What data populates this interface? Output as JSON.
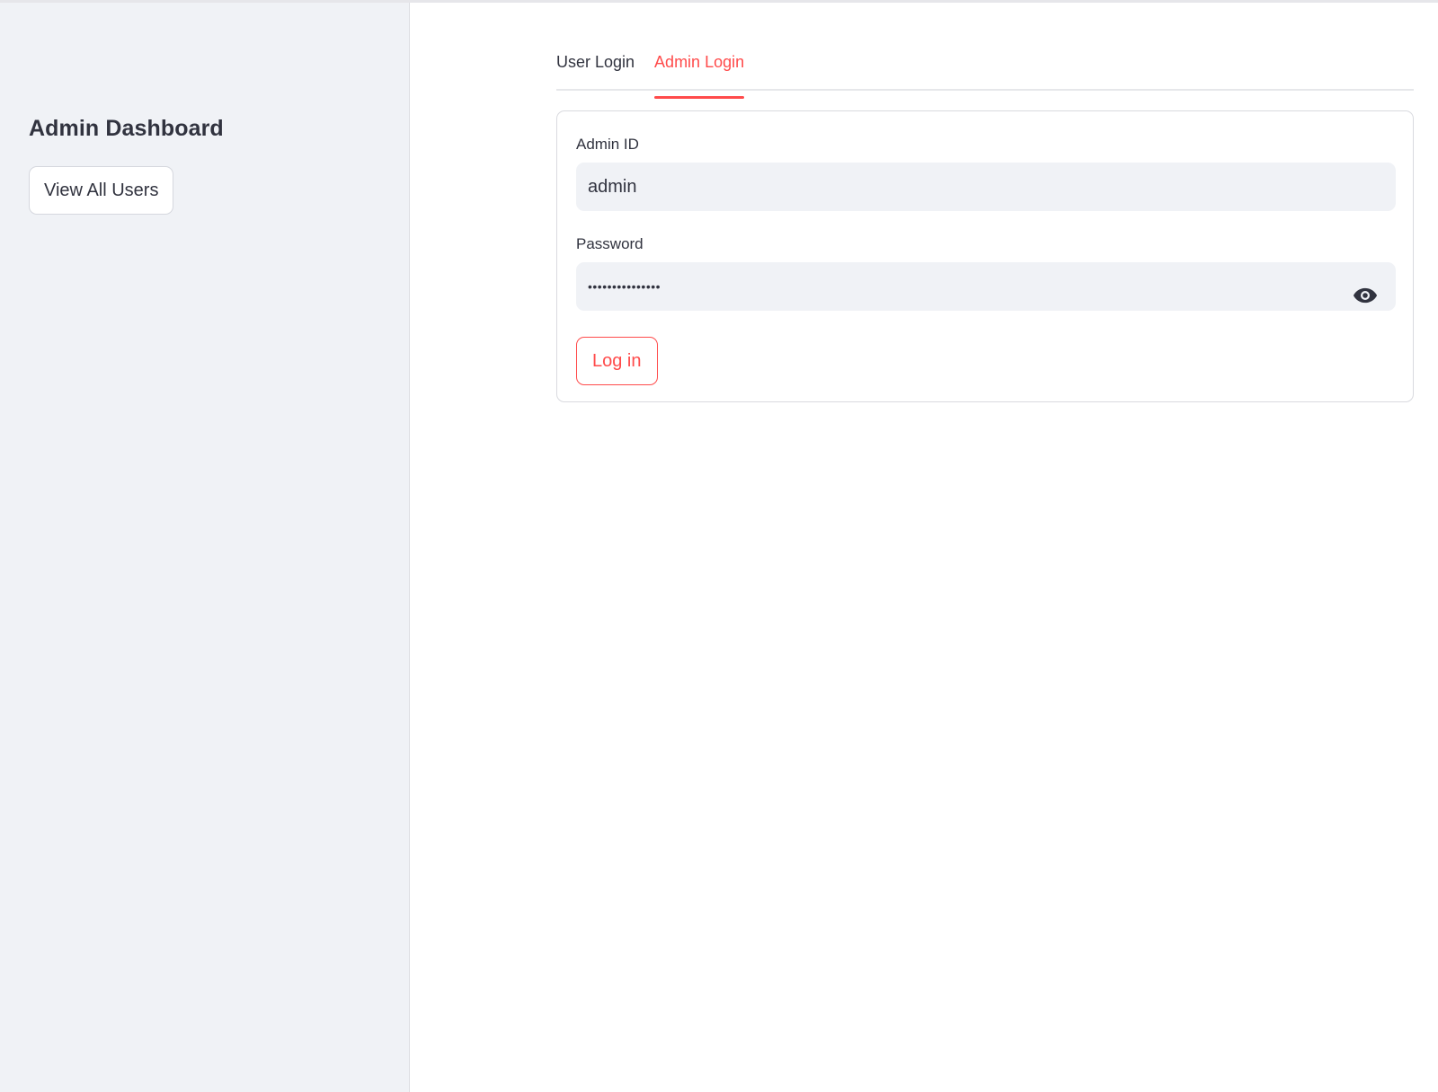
{
  "sidebar": {
    "title": "Admin Dashboard",
    "button_label": "View All Users"
  },
  "tabs": [
    {
      "label": "User Login",
      "active": false
    },
    {
      "label": "Admin Login",
      "active": true
    }
  ],
  "form": {
    "admin_id": {
      "label": "Admin ID",
      "value": "admin"
    },
    "password": {
      "label": "Password",
      "masked_value": "•••••••••••••••",
      "toggle_icon": "eye-icon"
    },
    "submit_label": "Log in"
  },
  "colors": {
    "accent": "#ff4b4b",
    "sidebar_bg": "#f0f2f6",
    "input_bg": "#f0f2f6",
    "text": "#31333f"
  }
}
